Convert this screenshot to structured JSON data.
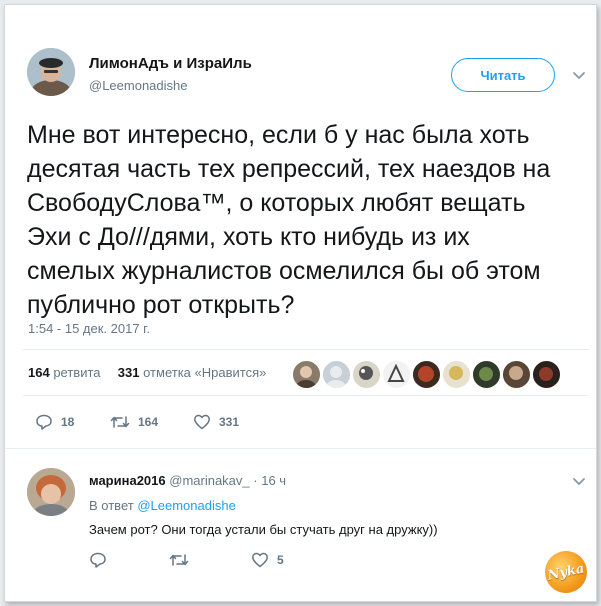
{
  "tweet": {
    "author_name": "ЛимонАдъ и ИзраИль",
    "author_handle": "@Leemonadishe",
    "follow_label": "Читать",
    "text": "Мне вот интересно, если б у нас была хоть\nдесятая часть тех репрессий, тех наездов на\nСвободуСлова™, о которых любят вещать\nЭхи с До///дями, хоть кто нибудь из их\nсмелых журналистов осмелился бы об этом\nпублично рот открыть?",
    "timestamp": "1:54 - 15 дек. 2017 г.",
    "retweets_count": "164",
    "retweets_label": "ретвита",
    "likes_count": "331",
    "likes_label": "отметка «Нравится»",
    "actions": {
      "reply_count": "18",
      "retweet_count": "164",
      "like_count": "331"
    }
  },
  "reply": {
    "author_name": "марина2016",
    "author_handle": "@marinakav_",
    "time": "· 16 ч",
    "in_reply_prefix": "В ответ",
    "in_reply_handle": "@Leemonadishe",
    "text": "Зачем рот? Они тогда устали бы стучать друг на дружку))",
    "actions": {
      "like_count": "5"
    }
  },
  "watermark": "Nyka",
  "colors": {
    "accent": "#1da1f2",
    "muted": "#657786",
    "text": "#14171a",
    "watermark": "#f39a1a"
  },
  "likers_avatars": [
    "avatar-1",
    "avatar-2",
    "avatar-3",
    "avatar-4",
    "avatar-5",
    "avatar-6",
    "avatar-7",
    "avatar-8",
    "avatar-9"
  ]
}
